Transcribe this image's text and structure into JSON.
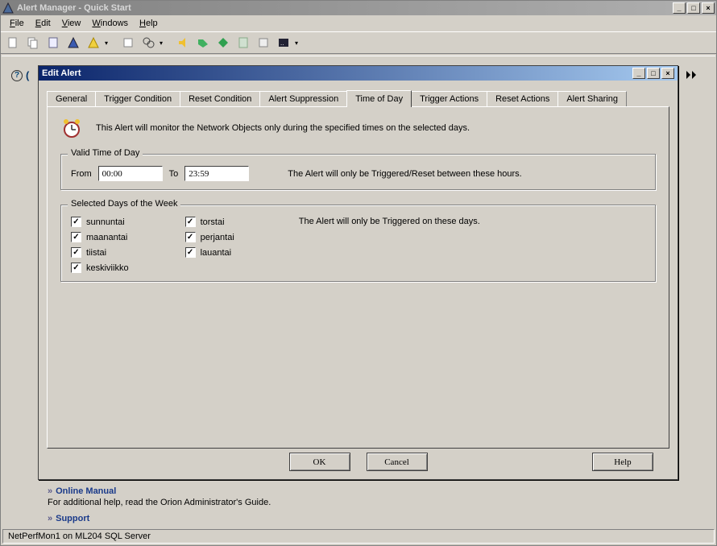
{
  "main_window": {
    "title": "Alert Manager - Quick Start"
  },
  "menubar": {
    "file": "File",
    "edit": "Edit",
    "view": "View",
    "windows": "Windows",
    "help": "Help"
  },
  "dialog": {
    "title": "Edit Alert",
    "tabs": {
      "general": "General",
      "trigger_condition": "Trigger Condition",
      "reset_condition": "Reset Condition",
      "alert_suppression": "Alert Suppression",
      "time_of_day": "Time of Day",
      "trigger_actions": "Trigger Actions",
      "reset_actions": "Reset Actions",
      "alert_sharing": "Alert Sharing"
    },
    "intro": "This Alert will monitor the Network Objects only during the specified times on the selected days.",
    "valid_time": {
      "legend": "Valid Time of Day",
      "from_label": "From",
      "from_value": "00:00",
      "to_label": "To",
      "to_value": "23:59",
      "hint": "The Alert will only be Triggered/Reset between these hours."
    },
    "days": {
      "legend": "Selected Days of the Week",
      "hint": "The Alert will only be Triggered on these days.",
      "items": [
        {
          "label": "sunnuntai",
          "checked": true
        },
        {
          "label": "maanantai",
          "checked": true
        },
        {
          "label": "tiistai",
          "checked": true
        },
        {
          "label": "keskiviikko",
          "checked": true
        },
        {
          "label": "torstai",
          "checked": true
        },
        {
          "label": "perjantai",
          "checked": true
        },
        {
          "label": "lauantai",
          "checked": true
        }
      ]
    },
    "buttons": {
      "ok": "OK",
      "cancel": "Cancel",
      "help": "Help"
    }
  },
  "background": {
    "online_manual": "Online Manual",
    "online_manual_desc": "For additional help, read the Orion Administrator's Guide.",
    "support": "Support"
  },
  "statusbar": {
    "text": "NetPerfMon1 on ML204 SQL Server"
  }
}
